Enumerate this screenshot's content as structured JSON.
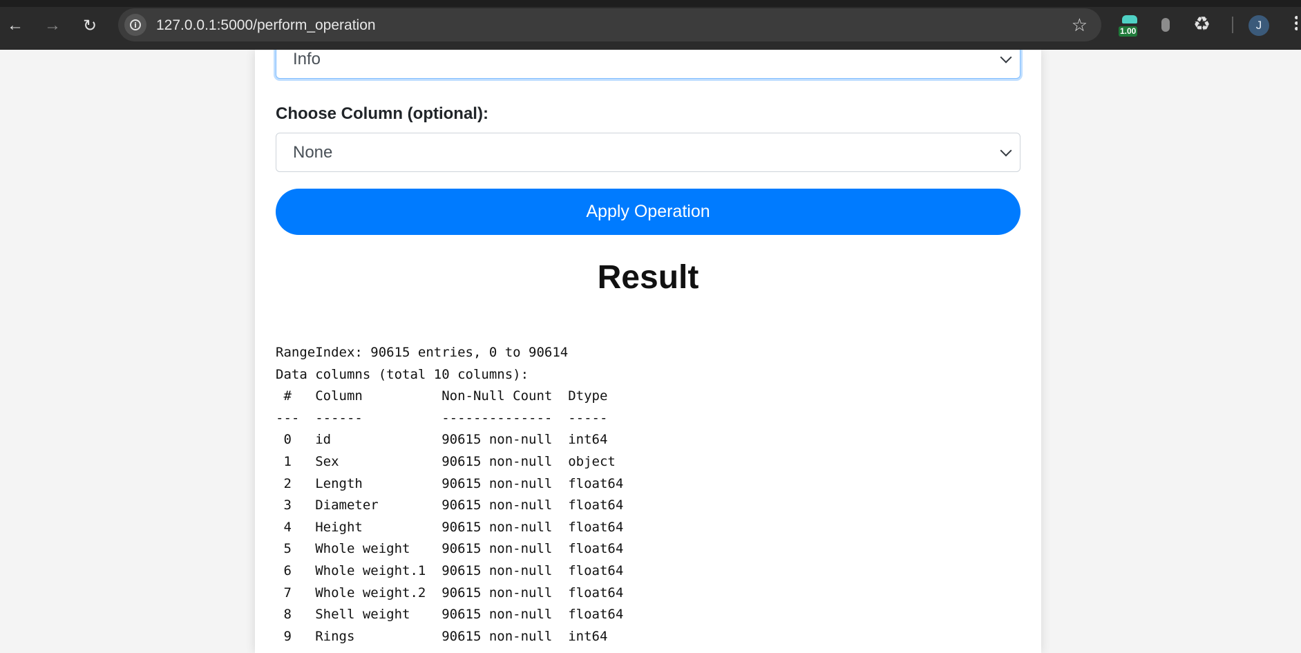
{
  "browser": {
    "url": "127.0.0.1:5000/perform_operation",
    "extension_badge": "1.00",
    "profile_initial": "J"
  },
  "form": {
    "operation_selected": "Info",
    "column_label": "Choose Column (optional):",
    "column_selected": "None",
    "apply_label": "Apply Operation"
  },
  "result": {
    "title": "Result",
    "output": "RangeIndex: 90615 entries, 0 to 90614\nData columns (total 10 columns):\n #   Column          Non-Null Count  Dtype  \n---  ------          --------------  -----  \n 0   id              90615 non-null  int64  \n 1   Sex             90615 non-null  object \n 2   Length          90615 non-null  float64\n 3   Diameter        90615 non-null  float64\n 4   Height          90615 non-null  float64\n 5   Whole weight    90615 non-null  float64\n 6   Whole weight.1  90615 non-null  float64\n 7   Whole weight.2  90615 non-null  float64\n 8   Shell weight    90615 non-null  float64\n 9   Rings           90615 non-null  int64  "
  },
  "colors": {
    "accent": "#007bff",
    "chrome": "#2b2b2b",
    "omnibox": "#3c3c3c"
  }
}
